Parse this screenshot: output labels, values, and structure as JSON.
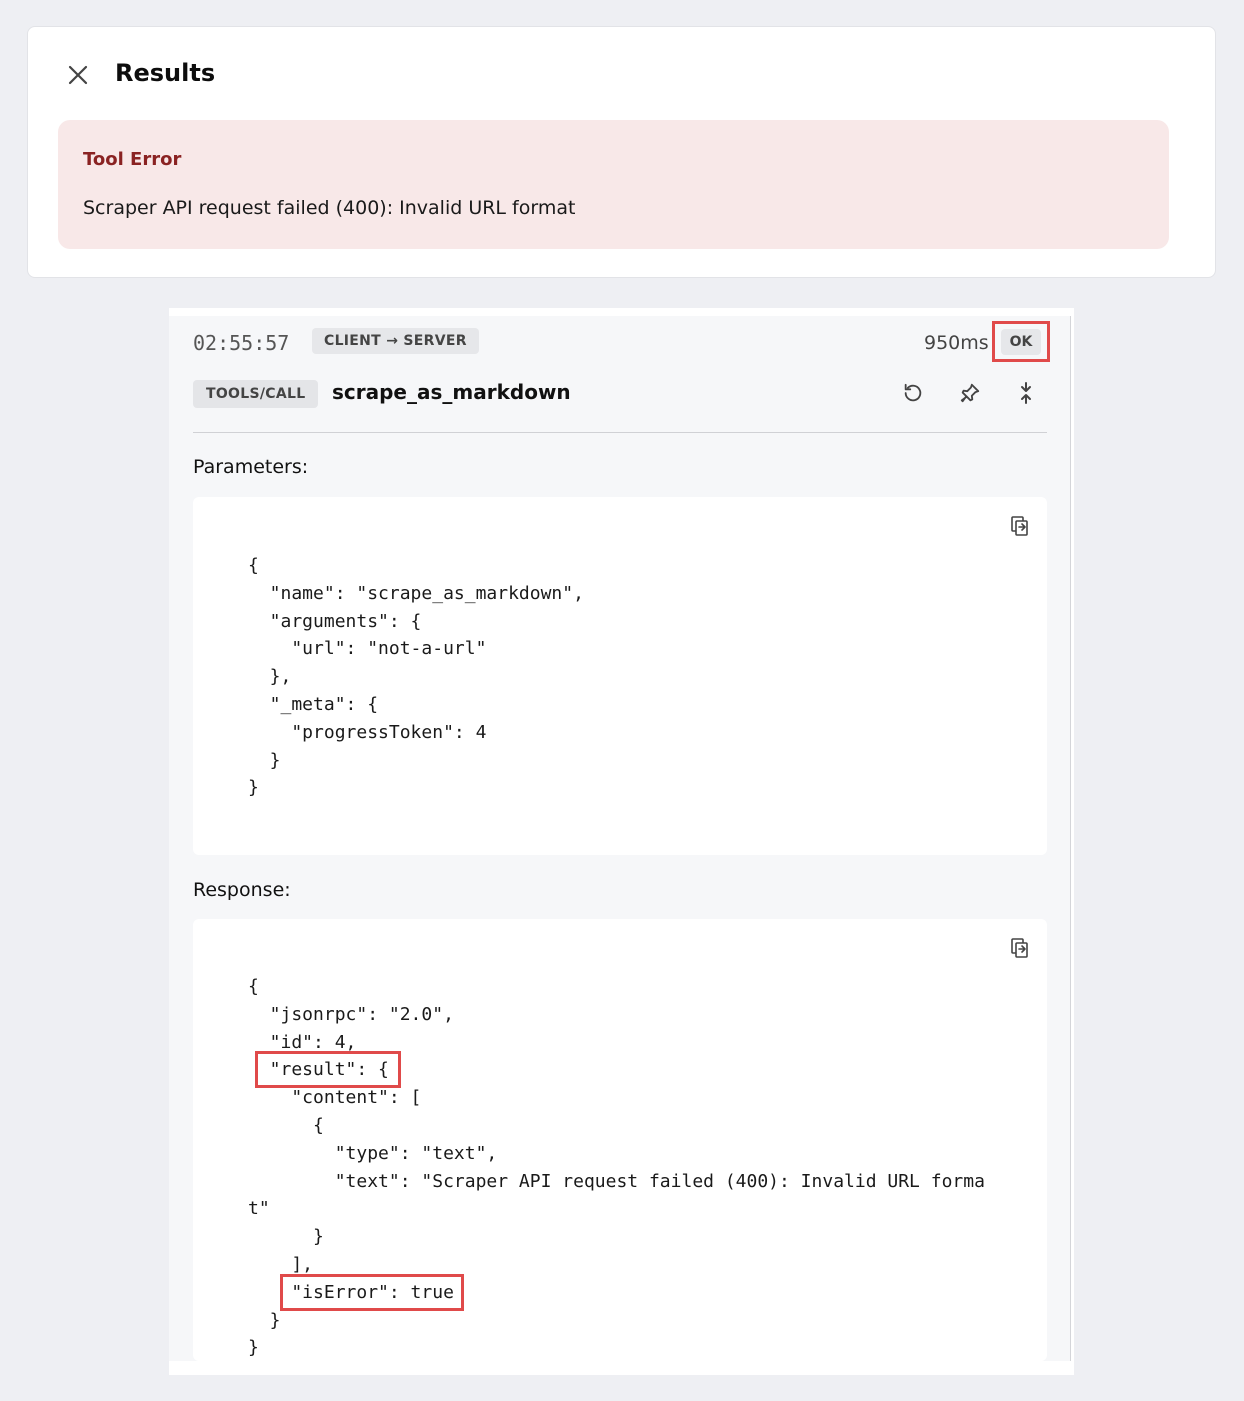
{
  "results": {
    "title": "Results",
    "error": {
      "title": "Tool Error",
      "message": "Scraper API request failed (400): Invalid URL format"
    }
  },
  "entry": {
    "timestamp": "02:55:57",
    "direction": "CLIENT → SERVER",
    "duration": "950ms",
    "status": "OK",
    "method": "TOOLS/CALL",
    "tool_name": "scrape_as_markdown",
    "actions": [
      "replay-icon",
      "pin-icon",
      "collapse-icon"
    ]
  },
  "parameters": {
    "label": "Parameters:",
    "code": "{\n  \"name\": \"scrape_as_markdown\",\n  \"arguments\": {\n    \"url\": \"not-a-url\"\n  },\n  \"_meta\": {\n    \"progressToken\": 4\n  }\n}"
  },
  "response": {
    "label": "Response:",
    "code": "{\n  \"jsonrpc\": \"2.0\",\n  \"id\": 4,\n  \"result\": {\n    \"content\": [\n      {\n        \"type\": \"text\",\n        \"text\": \"Scraper API request failed (400): Invalid URL forma\nt\"\n      }\n    ],\n    \"isError\": true\n  }\n}"
  },
  "colors": {
    "highlight": "#e04a4a",
    "error_bg": "#f8e8e8",
    "error_title": "#8a2222"
  }
}
